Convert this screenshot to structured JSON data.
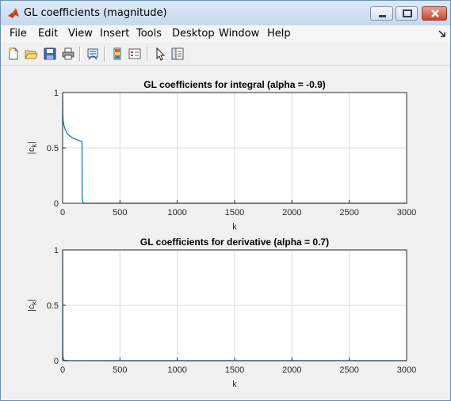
{
  "window": {
    "title": "GL coefficients (magnitude)"
  },
  "menu": [
    "File",
    "Edit",
    "View",
    "Insert",
    "Tools",
    "Desktop",
    "Window",
    "Help"
  ],
  "toolbar_icons": [
    "new-figure-icon",
    "open-file-icon",
    "save-icon",
    "print-icon",
    "link-plot-icon",
    "insert-colorbar-icon",
    "insert-legend-icon",
    "edit-plot-icon",
    "property-inspector-icon"
  ],
  "colors": {
    "line": "#0072bd",
    "grid": "#d9d9d9",
    "axes_bg": "#ffffff",
    "figure_bg": "#f0f0f0"
  },
  "chart_data": [
    {
      "type": "line",
      "title": "GL coefficients for integral (alpha = -0.9)",
      "xlabel": "k",
      "ylabel": "|c_k|",
      "xlim": [
        0,
        3000
      ],
      "ylim": [
        0,
        1
      ],
      "xticks": [
        "0",
        "500",
        "1000",
        "1500",
        "2000",
        "2500",
        "3000"
      ],
      "yticks": [
        "0",
        "0.5",
        "1"
      ],
      "grid": true,
      "series": [
        {
          "x": [
            0,
            1,
            2,
            4,
            8,
            15,
            25,
            40,
            60,
            80,
            100,
            120,
            140,
            160,
            169,
            170,
            171,
            175,
            180,
            200,
            500,
            1000,
            2000,
            3000
          ],
          "values": [
            1,
            0.9,
            0.8,
            0.75,
            0.72,
            0.69,
            0.66,
            0.63,
            0.61,
            0.595,
            0.585,
            0.575,
            0.567,
            0.56,
            0.558,
            0.15,
            0.05,
            0.02,
            0.0,
            0.0,
            0.0,
            0.0,
            0.0,
            0.0
          ]
        }
      ]
    },
    {
      "type": "line",
      "title": "GL coefficients for derivative (alpha = 0.7)",
      "xlabel": "k",
      "ylabel": "|c_k|",
      "xlim": [
        0,
        3000
      ],
      "ylim": [
        0,
        1
      ],
      "xticks": [
        "0",
        "500",
        "1000",
        "1500",
        "2000",
        "2500",
        "3000"
      ],
      "yticks": [
        "0",
        "0.5",
        "1"
      ],
      "grid": true,
      "series": [
        {
          "x": [
            0,
            1,
            2,
            3,
            5,
            8,
            12,
            20,
            50,
            100,
            500,
            1000,
            2000,
            3000
          ],
          "values": [
            1,
            0.7,
            0.105,
            0.045,
            0.02,
            0.01,
            0.006,
            0.003,
            0.001,
            0.0005,
            0.0,
            0.0,
            0.0,
            0.0
          ]
        }
      ]
    }
  ]
}
